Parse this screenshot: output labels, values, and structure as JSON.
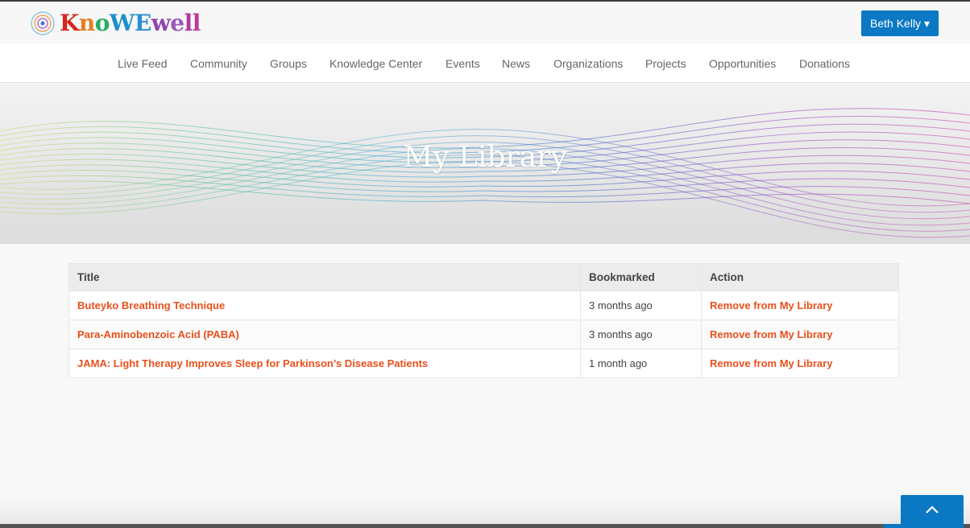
{
  "header": {
    "logo_text": "KnoWEwell",
    "user_menu_label": "Beth Kelly ▾"
  },
  "nav": {
    "items": [
      "Live Feed",
      "Community",
      "Groups",
      "Knowledge Center",
      "Events",
      "News",
      "Organizations",
      "Projects",
      "Opportunities",
      "Donations"
    ]
  },
  "hero": {
    "title": "My Library"
  },
  "library_table": {
    "columns": [
      "Title",
      "Bookmarked",
      "Action"
    ],
    "rows": [
      {
        "title": "Buteyko Breathing Technique",
        "bookmarked": "3 months ago",
        "action": "Remove from My Library"
      },
      {
        "title": "Para-Aminobenzoic Acid (PABA)",
        "bookmarked": "3 months ago",
        "action": "Remove from My Library"
      },
      {
        "title": "JAMA: Light Therapy Improves Sleep for Parkinson’s Disease Patients",
        "bookmarked": "1 month ago",
        "action": "Remove from My Library"
      }
    ]
  },
  "colors": {
    "accent_blue": "#0b78c4",
    "link_orange": "#e8501c"
  },
  "icons": {
    "scroll_top": "chevron-up-icon",
    "logo": "logo-icon"
  }
}
